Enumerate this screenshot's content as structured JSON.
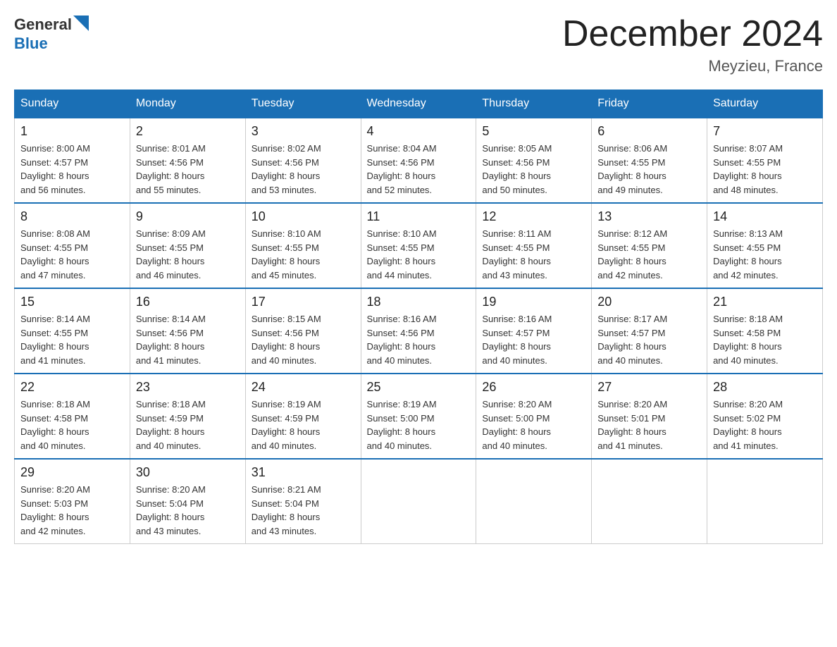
{
  "header": {
    "logo": {
      "general": "General",
      "blue": "Blue"
    },
    "title": "December 2024",
    "location": "Meyzieu, France"
  },
  "weekdays": [
    "Sunday",
    "Monday",
    "Tuesday",
    "Wednesday",
    "Thursday",
    "Friday",
    "Saturday"
  ],
  "weeks": [
    [
      {
        "day": "1",
        "sunrise": "8:00 AM",
        "sunset": "4:57 PM",
        "daylight": "8 hours and 56 minutes."
      },
      {
        "day": "2",
        "sunrise": "8:01 AM",
        "sunset": "4:56 PM",
        "daylight": "8 hours and 55 minutes."
      },
      {
        "day": "3",
        "sunrise": "8:02 AM",
        "sunset": "4:56 PM",
        "daylight": "8 hours and 53 minutes."
      },
      {
        "day": "4",
        "sunrise": "8:04 AM",
        "sunset": "4:56 PM",
        "daylight": "8 hours and 52 minutes."
      },
      {
        "day": "5",
        "sunrise": "8:05 AM",
        "sunset": "4:56 PM",
        "daylight": "8 hours and 50 minutes."
      },
      {
        "day": "6",
        "sunrise": "8:06 AM",
        "sunset": "4:55 PM",
        "daylight": "8 hours and 49 minutes."
      },
      {
        "day": "7",
        "sunrise": "8:07 AM",
        "sunset": "4:55 PM",
        "daylight": "8 hours and 48 minutes."
      }
    ],
    [
      {
        "day": "8",
        "sunrise": "8:08 AM",
        "sunset": "4:55 PM",
        "daylight": "8 hours and 47 minutes."
      },
      {
        "day": "9",
        "sunrise": "8:09 AM",
        "sunset": "4:55 PM",
        "daylight": "8 hours and 46 minutes."
      },
      {
        "day": "10",
        "sunrise": "8:10 AM",
        "sunset": "4:55 PM",
        "daylight": "8 hours and 45 minutes."
      },
      {
        "day": "11",
        "sunrise": "8:10 AM",
        "sunset": "4:55 PM",
        "daylight": "8 hours and 44 minutes."
      },
      {
        "day": "12",
        "sunrise": "8:11 AM",
        "sunset": "4:55 PM",
        "daylight": "8 hours and 43 minutes."
      },
      {
        "day": "13",
        "sunrise": "8:12 AM",
        "sunset": "4:55 PM",
        "daylight": "8 hours and 42 minutes."
      },
      {
        "day": "14",
        "sunrise": "8:13 AM",
        "sunset": "4:55 PM",
        "daylight": "8 hours and 42 minutes."
      }
    ],
    [
      {
        "day": "15",
        "sunrise": "8:14 AM",
        "sunset": "4:55 PM",
        "daylight": "8 hours and 41 minutes."
      },
      {
        "day": "16",
        "sunrise": "8:14 AM",
        "sunset": "4:56 PM",
        "daylight": "8 hours and 41 minutes."
      },
      {
        "day": "17",
        "sunrise": "8:15 AM",
        "sunset": "4:56 PM",
        "daylight": "8 hours and 40 minutes."
      },
      {
        "day": "18",
        "sunrise": "8:16 AM",
        "sunset": "4:56 PM",
        "daylight": "8 hours and 40 minutes."
      },
      {
        "day": "19",
        "sunrise": "8:16 AM",
        "sunset": "4:57 PM",
        "daylight": "8 hours and 40 minutes."
      },
      {
        "day": "20",
        "sunrise": "8:17 AM",
        "sunset": "4:57 PM",
        "daylight": "8 hours and 40 minutes."
      },
      {
        "day": "21",
        "sunrise": "8:18 AM",
        "sunset": "4:58 PM",
        "daylight": "8 hours and 40 minutes."
      }
    ],
    [
      {
        "day": "22",
        "sunrise": "8:18 AM",
        "sunset": "4:58 PM",
        "daylight": "8 hours and 40 minutes."
      },
      {
        "day": "23",
        "sunrise": "8:18 AM",
        "sunset": "4:59 PM",
        "daylight": "8 hours and 40 minutes."
      },
      {
        "day": "24",
        "sunrise": "8:19 AM",
        "sunset": "4:59 PM",
        "daylight": "8 hours and 40 minutes."
      },
      {
        "day": "25",
        "sunrise": "8:19 AM",
        "sunset": "5:00 PM",
        "daylight": "8 hours and 40 minutes."
      },
      {
        "day": "26",
        "sunrise": "8:20 AM",
        "sunset": "5:00 PM",
        "daylight": "8 hours and 40 minutes."
      },
      {
        "day": "27",
        "sunrise": "8:20 AM",
        "sunset": "5:01 PM",
        "daylight": "8 hours and 41 minutes."
      },
      {
        "day": "28",
        "sunrise": "8:20 AM",
        "sunset": "5:02 PM",
        "daylight": "8 hours and 41 minutes."
      }
    ],
    [
      {
        "day": "29",
        "sunrise": "8:20 AM",
        "sunset": "5:03 PM",
        "daylight": "8 hours and 42 minutes."
      },
      {
        "day": "30",
        "sunrise": "8:20 AM",
        "sunset": "5:04 PM",
        "daylight": "8 hours and 43 minutes."
      },
      {
        "day": "31",
        "sunrise": "8:21 AM",
        "sunset": "5:04 PM",
        "daylight": "8 hours and 43 minutes."
      },
      null,
      null,
      null,
      null
    ]
  ],
  "labels": {
    "sunrise": "Sunrise:",
    "sunset": "Sunset:",
    "daylight": "Daylight:"
  }
}
